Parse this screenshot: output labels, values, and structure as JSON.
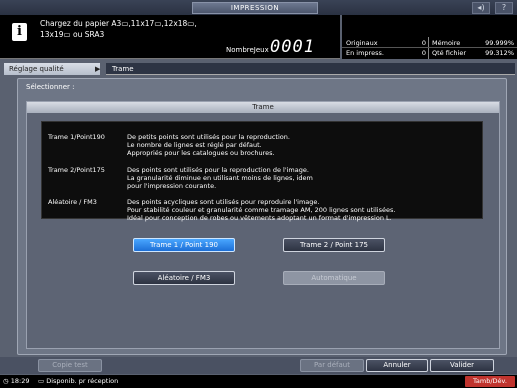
{
  "window": {
    "title": "IMPRESSION"
  },
  "header": {
    "message_line1": "Chargez du papier A3▭,11x17▭,12x18▭,",
    "message_line2": "13x19▭ ou SRA3",
    "counter_label": "NombreJeux",
    "counter_value": "0001"
  },
  "stats": {
    "originals_label": "Originaux",
    "originals_value": "0",
    "memory_label": "Mémoire",
    "memory_value": "99.999%",
    "printing_label": "En impress.",
    "printing_value": "0",
    "file_qty_label": "Qté fichier",
    "file_qty_value": "99.312%"
  },
  "breadcrumb": {
    "parent": "Réglage qualité",
    "current": "Trame"
  },
  "panel": {
    "select_label": "Sélectionner :",
    "section_title": "Trame",
    "descriptions": [
      {
        "name": "Trame 1/Point190",
        "lines": [
          "De petits points sont utilisés pour la reproduction.",
          "Le nombre de lignes est réglé par défaut.",
          "Appropriés pour les catalogues ou brochures."
        ]
      },
      {
        "name": "Trame 2/Point175",
        "lines": [
          "Des points sont utilisés pour la reproduction de l'image.",
          "La granularité diminue en utilisant moins de lignes, idem",
          "pour l'impression courante."
        ]
      },
      {
        "name": "Aléatoire / FM3",
        "lines": [
          "Des points acycliques sont utilisés pour reproduire l'image.",
          "Pour stabilité couleur et granularité comme tramage AM, 200 lignes sont utilisées.",
          "Idéal pour conception de robes ou vêtements adoptant un format d'impression L."
        ]
      }
    ],
    "options": {
      "screen1": "Trame 1 / Point 190",
      "screen2": "Trame 2 / Point 175",
      "stochastic": "Aléatoire / FM3",
      "auto": "Automatique"
    }
  },
  "footer": {
    "proof": "Copie test",
    "default": "Par défaut",
    "cancel": "Annuler",
    "ok": "Valider"
  },
  "status": {
    "time": "18:29",
    "availability": "Disponib. pr réception",
    "drum": "Tamb/Dév."
  },
  "colors": {
    "selected": "#1c6fd6",
    "drum_alert": "#c0342e"
  }
}
